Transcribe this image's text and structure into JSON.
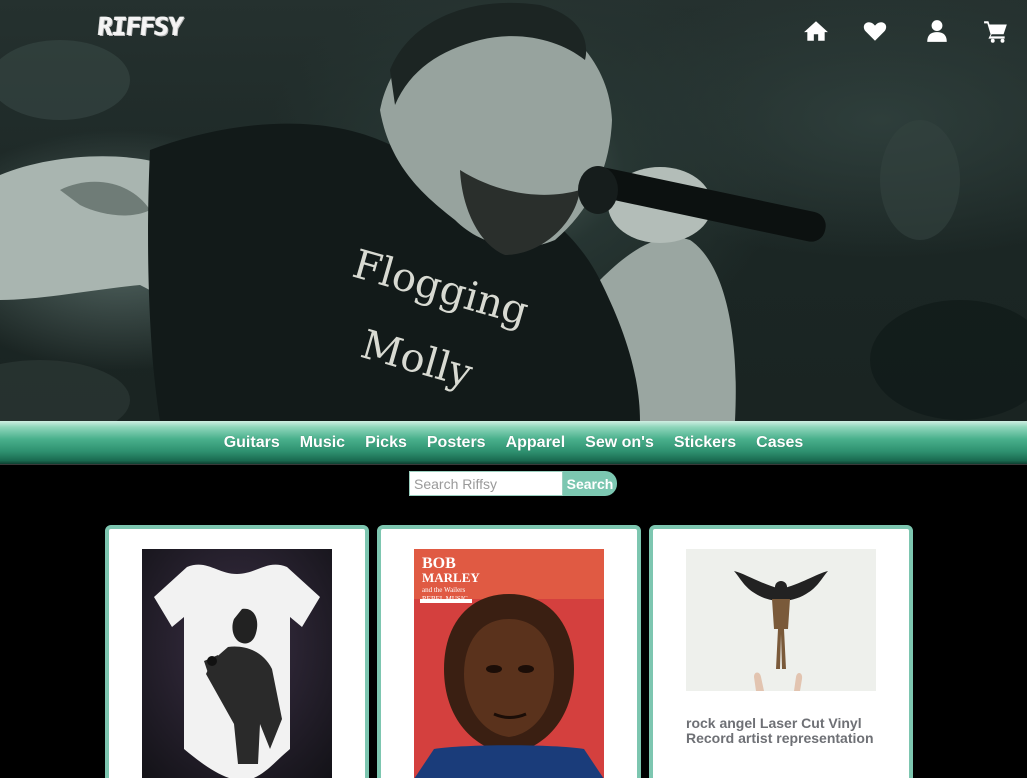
{
  "header": {
    "logo_text": "RIFFSY",
    "icons": [
      "home-icon",
      "heart-icon",
      "user-icon",
      "cart-icon"
    ]
  },
  "hero": {
    "shirt_text_line1": "Flogging",
    "shirt_text_line2": "Molly"
  },
  "nav": {
    "items": [
      "Guitars",
      "Music",
      "Picks",
      "Posters",
      "Apparel",
      "Sew on's",
      "Stickers",
      "Cases"
    ]
  },
  "search": {
    "placeholder": "Search Riffsy",
    "value": "",
    "button_label": "Search"
  },
  "products": [
    {
      "title": ""
    },
    {
      "title": "",
      "cover": {
        "line1": "BOB",
        "line2": "MARLEY",
        "line3": "and the Wailers",
        "line4": "REBEL MUSIC"
      }
    },
    {
      "title": "rock angel Laser Cut Vinyl Record artist representation"
    }
  ],
  "colors": {
    "accent": "#7dc6b0",
    "nav_green": "#2d8f6e",
    "product_title": "#6e7075"
  }
}
